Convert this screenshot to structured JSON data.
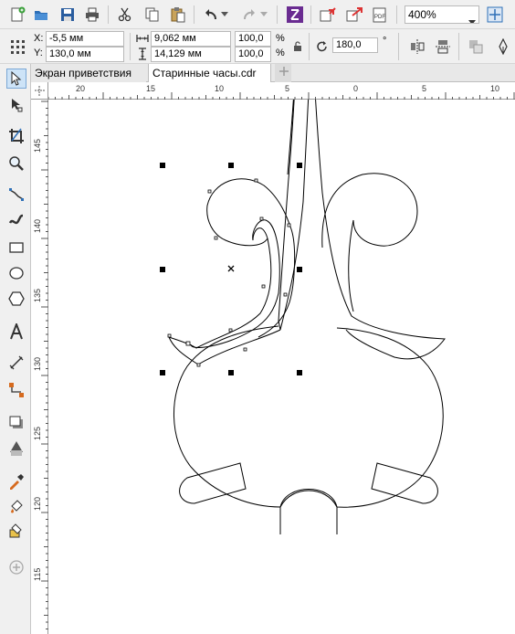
{
  "standard_toolbar": {
    "zoom_value": "400%"
  },
  "property_bar": {
    "x_label": "X:",
    "x_value": "-5,5 мм",
    "y_label": "Y:",
    "y_value": "130,0 мм",
    "width_value": "9,062 мм",
    "height_value": "14,129 мм",
    "scale_x": "100,0",
    "scale_y": "100,0",
    "percent_x": "%",
    "percent_y": "%",
    "angle_value": "180,0",
    "degree_symbol": "°"
  },
  "tabs": [
    {
      "label": "Экран приветствия",
      "active": false
    },
    {
      "label": "Старинные часы.cdr",
      "active": true
    }
  ],
  "ruler_h": [
    "20",
    "15",
    "10",
    "5",
    "0",
    "5",
    "10"
  ],
  "ruler_v": [
    "145",
    "140",
    "135",
    "130",
    "125",
    "120",
    "115"
  ],
  "colors": {
    "accent_purple": "#6a2c91",
    "toolbar_bg": "#f0f0f0",
    "canvas_bg": "#ffffff"
  }
}
